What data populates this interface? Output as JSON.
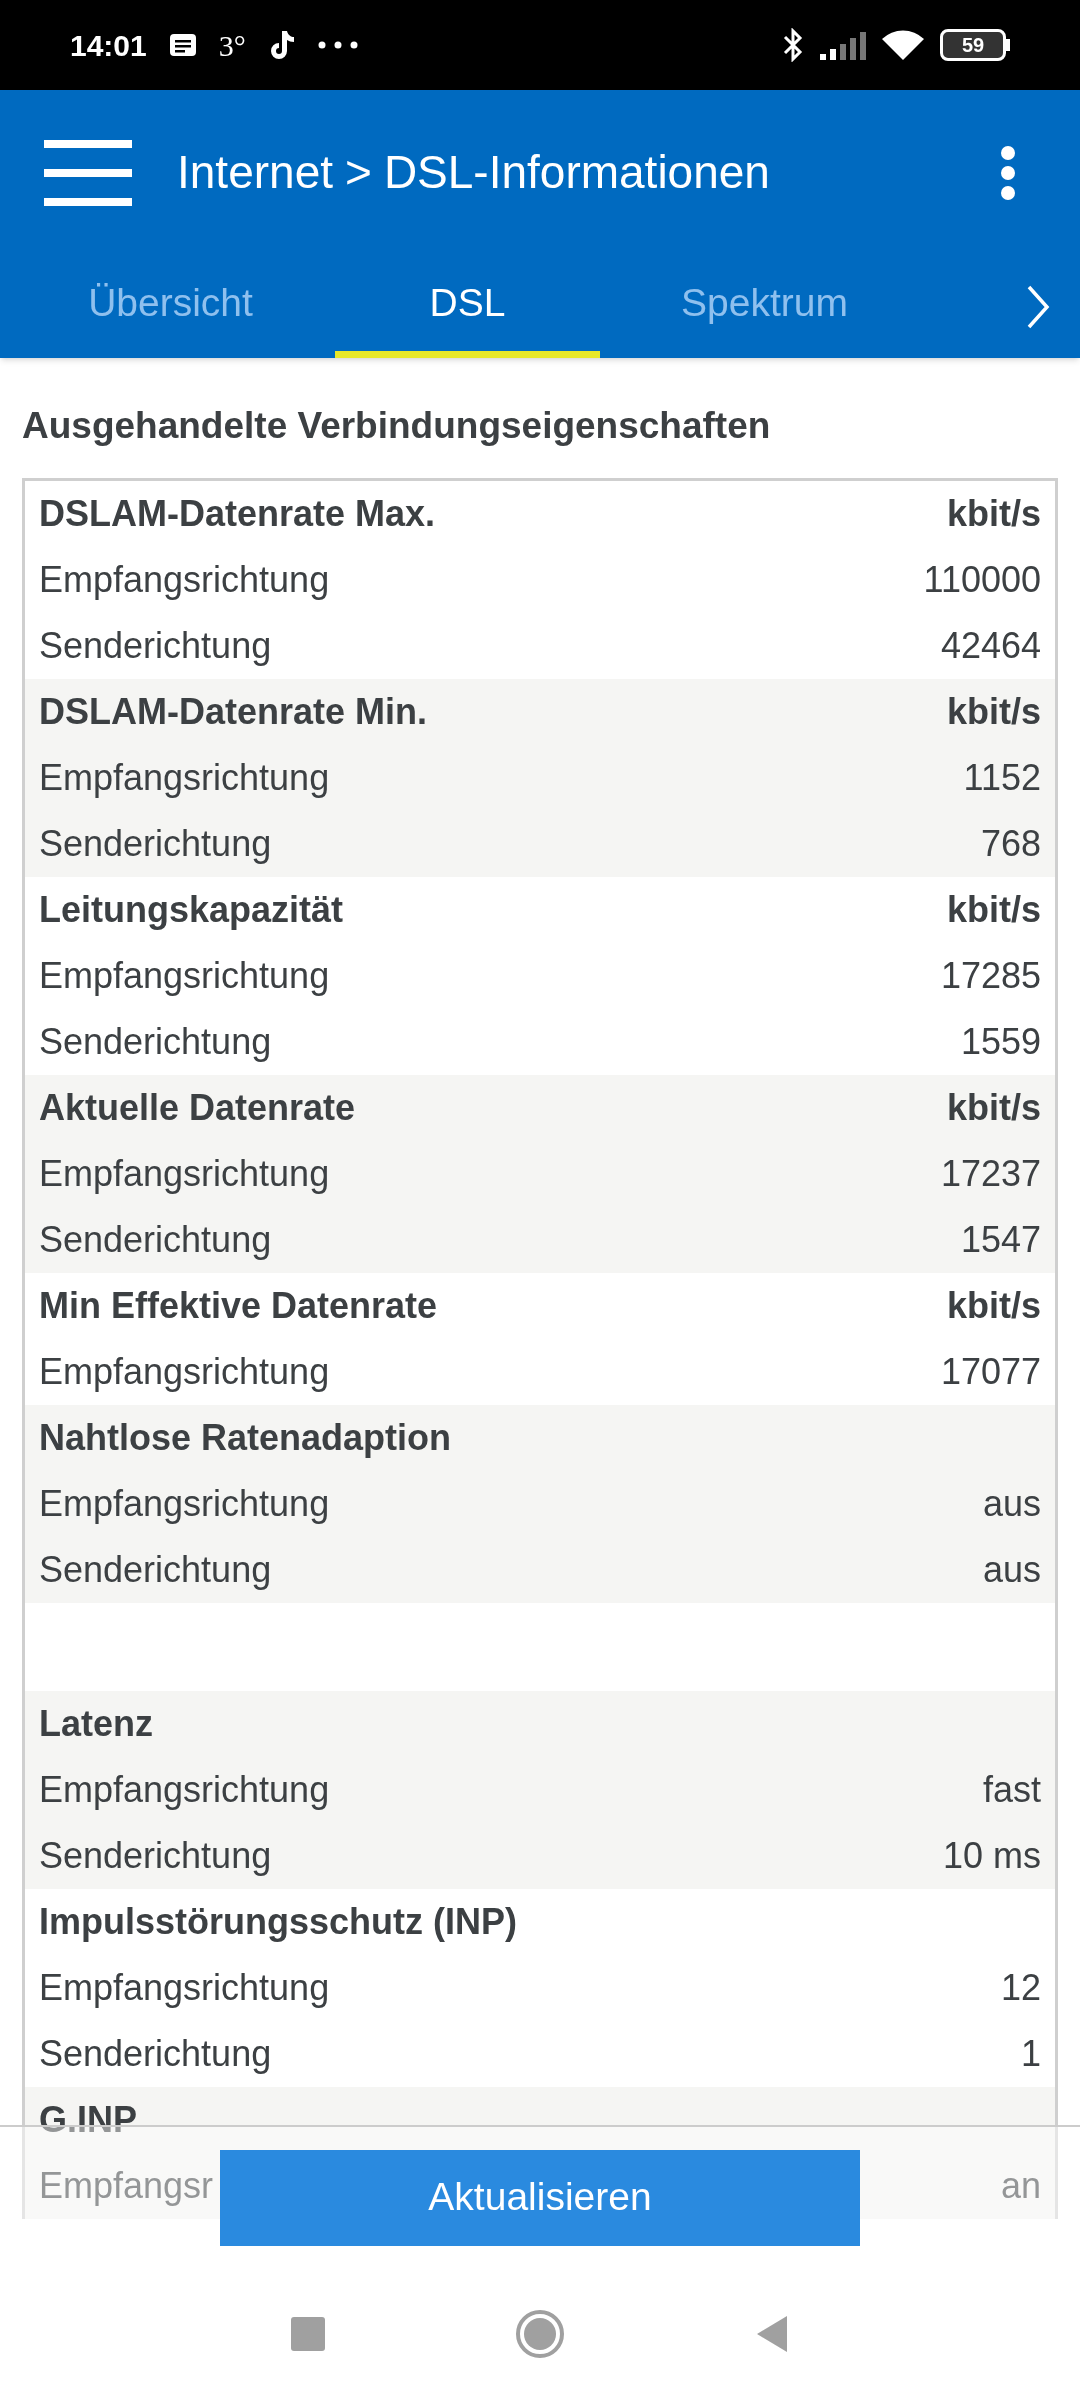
{
  "status_bar": {
    "time": "14:01",
    "notification_text": "3°",
    "battery": "59"
  },
  "header": {
    "breadcrumb_parent": "Internet",
    "breadcrumb_separator": ">",
    "title": "DSL-Informationen"
  },
  "tabs": [
    {
      "label": "Übersicht",
      "selected": false
    },
    {
      "label": "DSL",
      "selected": true
    },
    {
      "label": "Spektrum",
      "selected": false
    }
  ],
  "section_title": "Ausgehandelte Verbindungseigenschaften",
  "groups": [
    {
      "kind": "group",
      "title": "DSLAM-Datenrate Max.",
      "unit": "kbit/s",
      "rows": [
        {
          "label": "Empfangsrichtung",
          "value": "110000"
        },
        {
          "label": "Senderichtung",
          "value": "42464"
        }
      ]
    },
    {
      "kind": "group",
      "title": "DSLAM-Datenrate Min.",
      "unit": "kbit/s",
      "rows": [
        {
          "label": "Empfangsrichtung",
          "value": "1152"
        },
        {
          "label": "Senderichtung",
          "value": "768"
        }
      ]
    },
    {
      "kind": "group",
      "title": "Leitungskapazität",
      "unit": "kbit/s",
      "rows": [
        {
          "label": "Empfangsrichtung",
          "value": "17285"
        },
        {
          "label": "Senderichtung",
          "value": "1559"
        }
      ]
    },
    {
      "kind": "group",
      "title": "Aktuelle Datenrate",
      "unit": "kbit/s",
      "rows": [
        {
          "label": "Empfangsrichtung",
          "value": "17237"
        },
        {
          "label": "Senderichtung",
          "value": "1547"
        }
      ]
    },
    {
      "kind": "group",
      "title": "Min Effektive Datenrate",
      "unit": "kbit/s",
      "rows": [
        {
          "label": "Empfangsrichtung",
          "value": "17077"
        }
      ]
    },
    {
      "kind": "group",
      "title": "Nahtlose Ratenadaption",
      "rows": [
        {
          "label": "Empfangsrichtung",
          "value": "aus"
        },
        {
          "label": "Senderichtung",
          "value": "aus"
        }
      ]
    },
    {
      "kind": "spacer"
    },
    {
      "kind": "group",
      "title": "Latenz",
      "rows": [
        {
          "label": "Empfangsrichtung",
          "value": "fast"
        },
        {
          "label": "Senderichtung",
          "value": "10 ms"
        }
      ]
    },
    {
      "kind": "group",
      "title": "Impulsstörungsschutz (INP)",
      "rows": [
        {
          "label": "Empfangsrichtung",
          "value": "12"
        },
        {
          "label": "Senderichtung",
          "value": "1"
        }
      ]
    },
    {
      "kind": "group",
      "title": "G.INP",
      "rows": [
        {
          "label": "Empfangsr",
          "value": "an"
        }
      ]
    }
  ],
  "refresh_button": "Aktualisieren"
}
